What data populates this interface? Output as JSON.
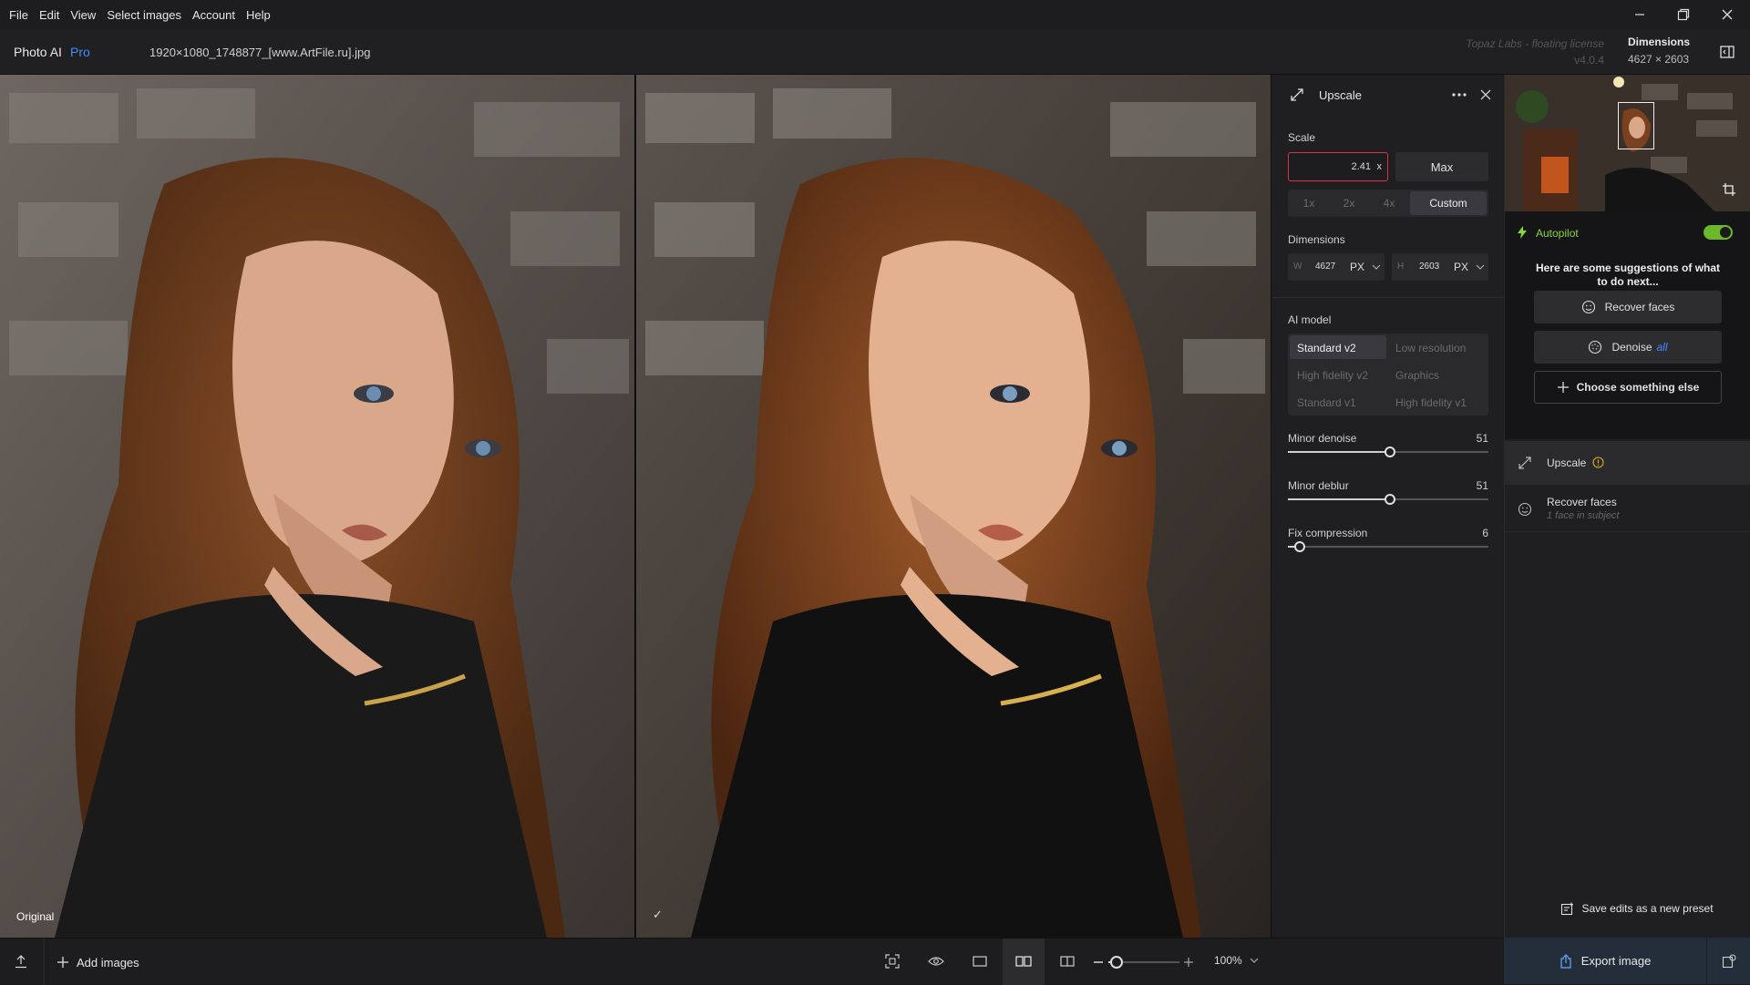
{
  "menu": [
    "File",
    "Edit",
    "View",
    "Select images",
    "Account",
    "Help"
  ],
  "header": {
    "app_name": "Photo AI",
    "app_tier": "Pro",
    "filename": "1920×1080_1748877_[www.ArtFile.ru].jpg",
    "license": "Topaz Labs - floating license",
    "version": "v4.0.4",
    "dimensions_label": "Dimensions",
    "dimensions_value": "4627 × 2603"
  },
  "viewer": {
    "original_label": "Original",
    "preview_mark": "✓"
  },
  "upscale_panel": {
    "title": "Upscale",
    "scale_label": "Scale",
    "scale_value": "2.41",
    "scale_unit": "x",
    "max_label": "Max",
    "presets": [
      "1x",
      "2x",
      "4x",
      "Custom"
    ],
    "active_preset": "Custom",
    "dimensions_label": "Dimensions",
    "width_prefix": "W",
    "width_value": "4627",
    "width_unit": "PX",
    "height_prefix": "H",
    "height_value": "2603",
    "height_unit": "PX",
    "ai_model_label": "AI model",
    "models": [
      "Standard v2",
      "Low resolution",
      "High fidelity v2",
      "Graphics",
      "Standard v1",
      "High fidelity v1"
    ],
    "active_model": "Standard v2",
    "sliders": [
      {
        "label": "Minor denoise",
        "value": 51,
        "fraction": 0.51
      },
      {
        "label": "Minor deblur",
        "value": 51,
        "fraction": 0.51
      },
      {
        "label": "Fix compression",
        "value": 6,
        "fraction": 0.06
      }
    ]
  },
  "autopilot": {
    "label": "Autopilot",
    "enabled": true,
    "suggestion_text": "Here are some suggestions of what to do next...",
    "suggestions": [
      {
        "label": "Recover faces",
        "extra": ""
      },
      {
        "label": "Denoise",
        "extra": "all"
      },
      {
        "label": "Choose something else",
        "extra": ""
      }
    ]
  },
  "filters": [
    {
      "label": "Upscale",
      "sublabel": ""
    },
    {
      "label": "Recover faces",
      "sublabel": "1 face in subject"
    }
  ],
  "save_preset_label": "Save edits as a new preset",
  "add_images_label": "Add images",
  "zoom_value": "100%",
  "export_label": "Export image",
  "colors": {
    "accent_green": "#8bd43a",
    "accent_blue": "#3f8cff",
    "export_bg": "#242e3a"
  }
}
